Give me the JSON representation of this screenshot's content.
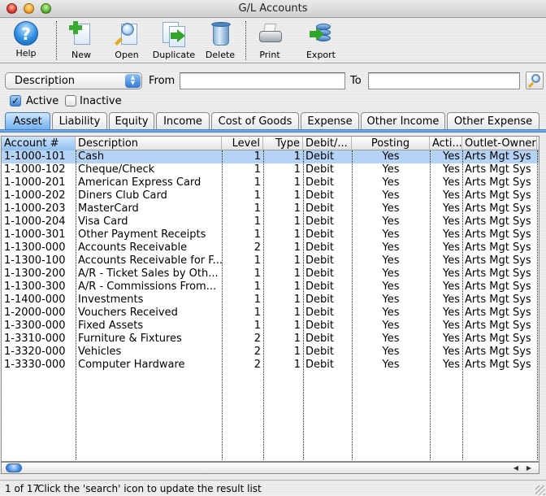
{
  "window": {
    "title": "G/L Accounts"
  },
  "toolbar": {
    "buttons": [
      {
        "label": "Help",
        "icon": "help-icon"
      },
      {
        "label": "New",
        "icon": "new-document-icon"
      },
      {
        "label": "Open",
        "icon": "open-magnifier-icon"
      },
      {
        "label": "Duplicate",
        "icon": "duplicate-icon"
      },
      {
        "label": "Delete",
        "icon": "trash-icon"
      },
      {
        "label": "Print",
        "icon": "printer-icon"
      },
      {
        "label": "Export",
        "icon": "export-database-icon"
      }
    ]
  },
  "search": {
    "field_select": "Description",
    "from_label": "From",
    "from_value": "",
    "to_label": "To",
    "to_value": ""
  },
  "filters": {
    "active": {
      "label": "Active",
      "checked": true
    },
    "inactive": {
      "label": "Inactive",
      "checked": false
    }
  },
  "tabs": [
    {
      "label": "Asset",
      "active": true
    },
    {
      "label": "Liability",
      "active": false
    },
    {
      "label": "Equity",
      "active": false
    },
    {
      "label": "Income",
      "active": false
    },
    {
      "label": "Cost of Goods",
      "active": false
    },
    {
      "label": "Expense",
      "active": false
    },
    {
      "label": "Other Income",
      "active": false
    },
    {
      "label": "Other Expense",
      "active": false
    }
  ],
  "table": {
    "columns": [
      "Account #",
      "Description",
      "Level",
      "Type",
      "Debit/...",
      "Posting",
      "Acti...",
      "Outlet-Owner"
    ],
    "rows": [
      [
        "1-1000-101",
        "Cash",
        "1",
        "1",
        "Debit",
        "Yes",
        "Yes",
        "Arts Mgt Sys"
      ],
      [
        "1-1000-102",
        "Cheque/Check",
        "1",
        "1",
        "Debit",
        "Yes",
        "Yes",
        "Arts Mgt Sys"
      ],
      [
        "1-1000-201",
        "American Express Card",
        "1",
        "1",
        "Debit",
        "Yes",
        "Yes",
        "Arts Mgt Sys"
      ],
      [
        "1-1000-202",
        "Diners Club Card",
        "1",
        "1",
        "Debit",
        "Yes",
        "Yes",
        "Arts Mgt Sys"
      ],
      [
        "1-1000-203",
        "MasterCard",
        "1",
        "1",
        "Debit",
        "Yes",
        "Yes",
        "Arts Mgt Sys"
      ],
      [
        "1-1000-204",
        "Visa Card",
        "1",
        "1",
        "Debit",
        "Yes",
        "Yes",
        "Arts Mgt Sys"
      ],
      [
        "1-1000-301",
        "Other Payment Receipts",
        "1",
        "1",
        "Debit",
        "Yes",
        "Yes",
        "Arts Mgt Sys"
      ],
      [
        "1-1300-000",
        "Accounts Receivable",
        "2",
        "1",
        "Debit",
        "Yes",
        "Yes",
        "Arts Mgt Sys"
      ],
      [
        "1-1300-100",
        "Accounts Receivable for F...",
        "1",
        "1",
        "Debit",
        "Yes",
        "Yes",
        "Arts Mgt Sys"
      ],
      [
        "1-1300-200",
        "A/R - Ticket Sales by Oth...",
        "1",
        "1",
        "Debit",
        "Yes",
        "Yes",
        "Arts Mgt Sys"
      ],
      [
        "1-1300-300",
        "A/R - Commissions From...",
        "1",
        "1",
        "Debit",
        "Yes",
        "Yes",
        "Arts Mgt Sys"
      ],
      [
        "1-1400-000",
        "Investments",
        "1",
        "1",
        "Debit",
        "Yes",
        "Yes",
        "Arts Mgt Sys"
      ],
      [
        "1-2000-000",
        "Vouchers Received",
        "1",
        "1",
        "Debit",
        "Yes",
        "Yes",
        "Arts Mgt Sys"
      ],
      [
        "1-3300-000",
        "Fixed Assets",
        "1",
        "1",
        "Debit",
        "Yes",
        "Yes",
        "Arts Mgt Sys"
      ],
      [
        "1-3310-000",
        "Furniture & Fixtures",
        "2",
        "1",
        "Debit",
        "Yes",
        "Yes",
        "Arts Mgt Sys"
      ],
      [
        "1-3320-000",
        "Vehicles",
        "2",
        "1",
        "Debit",
        "Yes",
        "Yes",
        "Arts Mgt Sys"
      ],
      [
        "1-3330-000",
        "Computer Hardware",
        "2",
        "1",
        "Debit",
        "Yes",
        "Yes",
        "Arts Mgt Sys"
      ]
    ],
    "selected_row": 0
  },
  "status": {
    "count": "1 of 17",
    "message": "Click the 'search' icon to update the result list"
  },
  "colors": {
    "selection": "#b4d3f7",
    "accent": "#3b84dc"
  }
}
